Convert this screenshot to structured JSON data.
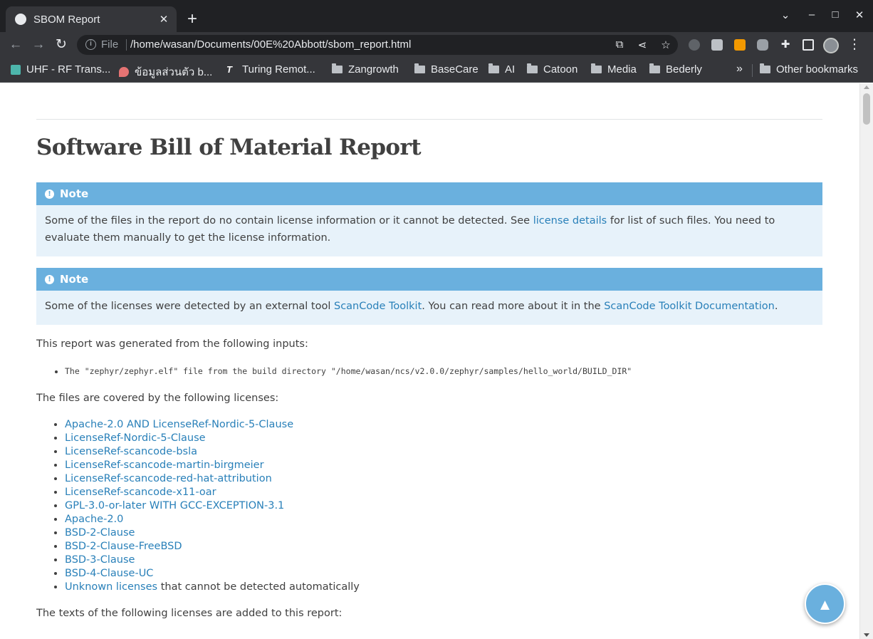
{
  "browser": {
    "tab": {
      "title": "SBOM Report",
      "close": "✕"
    },
    "new_tab": "+",
    "window_controls": {
      "tab_search": "⌄",
      "minimize": "–",
      "maximize": "□",
      "close": "✕"
    },
    "nav": {
      "back": "←",
      "forward": "→",
      "reload": "↻"
    },
    "omnibox": {
      "scheme": "File",
      "url": "/home/wasan/Documents/00E%20Abbott/sbom_report.html"
    },
    "icons": [
      "translate-icon",
      "share-icon",
      "bookmark-star-icon",
      "extension-bulb-icon",
      "extension-office-icon",
      "extension-orange-icon",
      "extension-chat-icon",
      "extensions-puzzle-icon",
      "side-panel-icon",
      "profile-avatar",
      "menu-kebab-icon"
    ],
    "bookmarks": [
      {
        "label": "UHF - RF Trans...",
        "type": "site",
        "color": "#4db6ac"
      },
      {
        "label": "ข้อมูลส่วนตัว b...",
        "type": "site",
        "color": "#e57373"
      },
      {
        "label": "Turing Remot...",
        "type": "site",
        "color": "#ffffff"
      },
      {
        "label": "Zangrowth",
        "type": "folder"
      },
      {
        "label": "BaseCare",
        "type": "folder"
      },
      {
        "label": "AI",
        "type": "folder"
      },
      {
        "label": "Catoon",
        "type": "folder"
      },
      {
        "label": "Media",
        "type": "folder"
      },
      {
        "label": "Bederly",
        "type": "folder"
      }
    ],
    "bookmarks_overflow": "»",
    "other_bookmarks": "Other bookmarks"
  },
  "page": {
    "title": "Software Bill of Material Report",
    "note1": {
      "title": "Note",
      "text_before": "Some of the files in the report do no contain license information or it cannot be detected. See ",
      "link": "license details",
      "text_after": " for list of such files. You need to evaluate them manually to get the license information."
    },
    "note2": {
      "title": "Note",
      "text_before": "Some of the licenses were detected by an external tool ",
      "link1": "ScanCode Toolkit",
      "text_middle": ". You can read more about it in the ",
      "link2": "ScanCode Toolkit Documentation",
      "text_after": "."
    },
    "inputs_intro": "This report was generated from the following inputs:",
    "inputs": [
      "The \"zephyr/zephyr.elf\" file from the build directory \"/home/wasan/ncs/v2.0.0/zephyr/samples/hello_world/BUILD_DIR\""
    ],
    "licenses_intro": "The files are covered by the following licenses:",
    "licenses": [
      "Apache-2.0 AND LicenseRef-Nordic-5-Clause",
      "LicenseRef-Nordic-5-Clause",
      "LicenseRef-scancode-bsla",
      "LicenseRef-scancode-martin-birgmeier",
      "LicenseRef-scancode-red-hat-attribution",
      "LicenseRef-scancode-x11-oar",
      "GPL-3.0-or-later WITH GCC-EXCEPTION-3.1",
      "Apache-2.0",
      "BSD-2-Clause",
      "BSD-2-Clause-FreeBSD",
      "BSD-3-Clause",
      "BSD-4-Clause-UC"
    ],
    "unknown_licenses": {
      "link": "Unknown licenses",
      "text": " that cannot be detected automatically"
    },
    "texts_intro": "The texts of the following licenses are added to this report:",
    "scroll_top_button": "▲"
  },
  "colors": {
    "link": "#2980b9",
    "admonition_title": "#6ab0de",
    "admonition_body": "#e7f2fa",
    "text": "#404040"
  }
}
